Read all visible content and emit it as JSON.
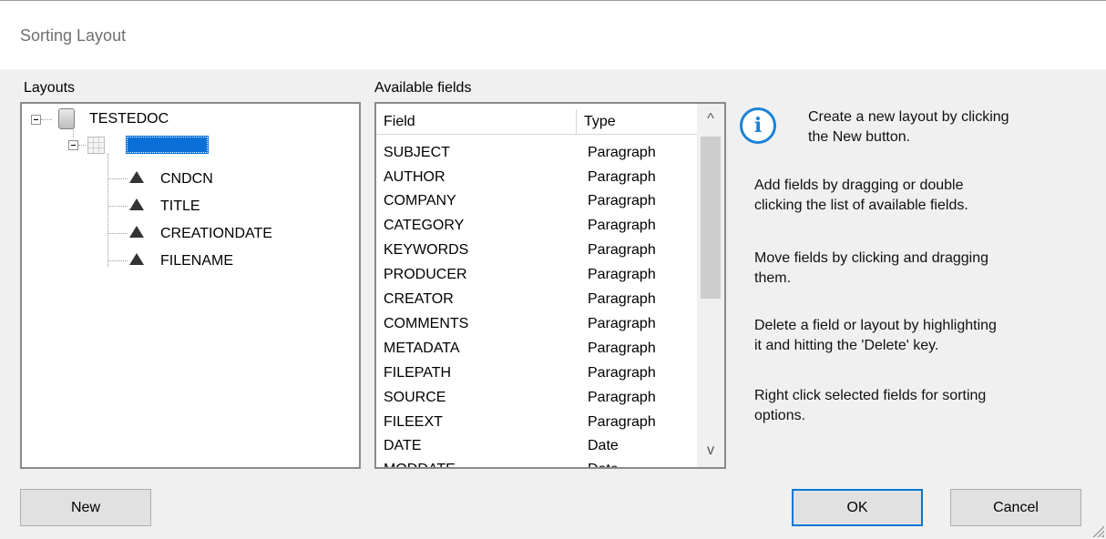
{
  "window": {
    "title": "Sorting Layout"
  },
  "layouts": {
    "label": "Layouts",
    "root": {
      "name": "TESTEDOC"
    },
    "children": [
      "CNDCN",
      "TITLE",
      "CREATIONDATE",
      "FILENAME"
    ]
  },
  "fields": {
    "label": "Available fields",
    "columns": {
      "field": "Field",
      "type": "Type"
    },
    "rows": [
      {
        "field": "SUBJECT",
        "type": "Paragraph"
      },
      {
        "field": "AUTHOR",
        "type": "Paragraph"
      },
      {
        "field": "COMPANY",
        "type": "Paragraph"
      },
      {
        "field": "CATEGORY",
        "type": "Paragraph"
      },
      {
        "field": "KEYWORDS",
        "type": "Paragraph"
      },
      {
        "field": "PRODUCER",
        "type": "Paragraph"
      },
      {
        "field": "CREATOR",
        "type": "Paragraph"
      },
      {
        "field": "COMMENTS",
        "type": "Paragraph"
      },
      {
        "field": "METADATA",
        "type": "Paragraph"
      },
      {
        "field": "FILEPATH",
        "type": "Paragraph"
      },
      {
        "field": "SOURCE",
        "type": "Paragraph"
      },
      {
        "field": "FILEEXT",
        "type": "Paragraph"
      },
      {
        "field": "DATE",
        "type": "Date"
      },
      {
        "field": "MODDATE",
        "type": "Date"
      }
    ],
    "scroll_up": "^",
    "scroll_down": "v"
  },
  "info": {
    "icon": "info-icon",
    "icon_glyph": "i",
    "lines": [
      "Create a new layout by clicking",
      "the New button.",
      "Add fields by dragging or double",
      "clicking the list of available fields.",
      "Move fields by clicking and dragging",
      "them.",
      "Delete a field or layout by highlighting",
      "it and hitting the 'Delete' key.",
      "Right click selected fields for sorting",
      "options."
    ]
  },
  "buttons": {
    "new": "New",
    "ok": "OK",
    "cancel": "Cancel"
  },
  "colors": {
    "accent": "#0078d7",
    "selection": "#0a70d8",
    "info": "#1a82d8"
  }
}
